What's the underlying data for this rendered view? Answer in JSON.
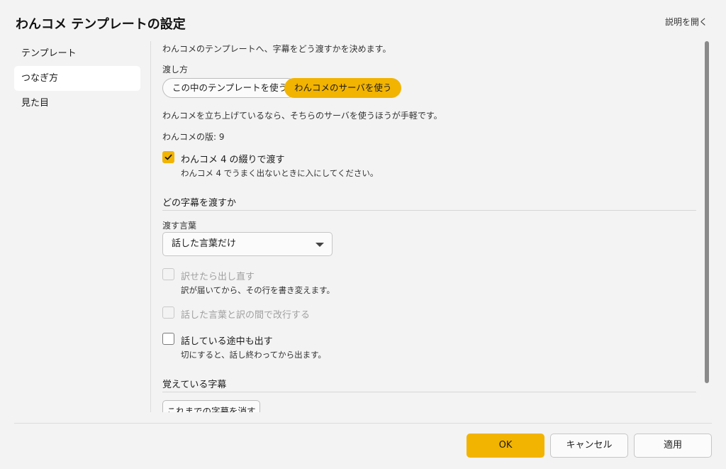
{
  "window": {
    "title": "わんコメ テンプレートの設定",
    "help_link": "説明を開く"
  },
  "sidebar": {
    "items": [
      {
        "label": "テンプレート",
        "selected": false
      },
      {
        "label": "つなぎ方",
        "selected": true
      },
      {
        "label": "見た目",
        "selected": false
      }
    ]
  },
  "main": {
    "intro": "わんコメのテンプレートへ、字幕をどう渡すかを決めます。",
    "delivery": {
      "label": "渡し方",
      "options": [
        "この中のテンプレートを使う",
        "わんコメのサーバを使う"
      ],
      "selected": "わんコメのサーバを使う",
      "hint": "わんコメを立ち上げているなら、そちらのサーバを使うほうが手軽です。",
      "version_text": "わんコメの版: 9"
    },
    "v4_checkbox": {
      "label": "わんコメ 4 の綴りで渡す",
      "desc": "わんコメ 4 でうまく出ないときに入にしてください。",
      "checked": true
    },
    "which_section": {
      "heading": "どの字幕を渡すか",
      "words_label": "渡す言葉",
      "words_value": "話した言葉だけ",
      "resend": {
        "label": "訳せたら出し直す",
        "desc": "訳が届いてから、その行を書き変えます。",
        "checked": false,
        "disabled": true
      },
      "newline": {
        "label": "話した言葉と訳の間で改行する",
        "checked": false,
        "disabled": true
      },
      "partial": {
        "label": "話している途中も出す",
        "desc": "切にすると、話し終わってから出ます。",
        "checked": false,
        "disabled": false
      }
    },
    "memory_section": {
      "heading": "覚えている字幕",
      "clear_button": "これまでの字幕を消す"
    }
  },
  "footer": {
    "ok": "OK",
    "cancel": "キャンセル",
    "apply": "適用"
  },
  "colors": {
    "accent": "#f2b400",
    "background": "#f3f3f3"
  }
}
